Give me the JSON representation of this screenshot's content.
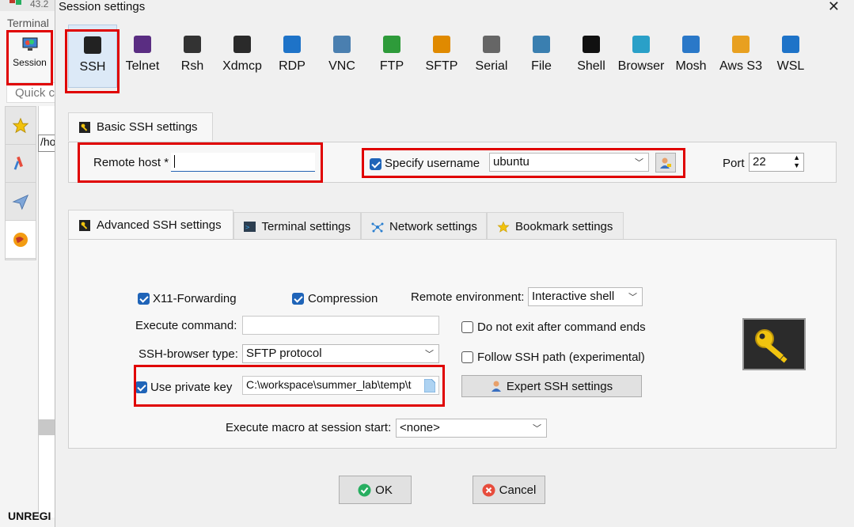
{
  "background_app": {
    "title_fragment": "43.2",
    "terminal_label": "Terminal",
    "session_button": "Session",
    "quick_connect": "Quick c",
    "path_fragment": "/ho",
    "unregistered": "UNREGI"
  },
  "dialog": {
    "title": "Session settings",
    "close": "✕"
  },
  "protocols": [
    {
      "label": "SSH",
      "icon": "ssh-key-icon",
      "color": "#222222",
      "selected": true
    },
    {
      "label": "Telnet",
      "icon": "telnet-icon",
      "color": "#5a2d82"
    },
    {
      "label": "Rsh",
      "icon": "rsh-icon",
      "color": "#333333"
    },
    {
      "label": "Xdmcp",
      "icon": "xdmcp-icon",
      "color": "#2a2a2a"
    },
    {
      "label": "RDP",
      "icon": "rdp-windows-icon",
      "color": "#1e73c8"
    },
    {
      "label": "VNC",
      "icon": "vnc-icon",
      "color": "#4a7fb0"
    },
    {
      "label": "FTP",
      "icon": "ftp-globe-icon",
      "color": "#2e9b3a"
    },
    {
      "label": "SFTP",
      "icon": "sftp-icon",
      "color": "#e08a00"
    },
    {
      "label": "Serial",
      "icon": "serial-plug-icon",
      "color": "#666666"
    },
    {
      "label": "File",
      "icon": "file-monitor-icon",
      "color": "#3a7fb0"
    },
    {
      "label": "Shell",
      "icon": "shell-terminal-icon",
      "color": "#111111"
    },
    {
      "label": "Browser",
      "icon": "browser-globe-icon",
      "color": "#2aa0c8"
    },
    {
      "label": "Mosh",
      "icon": "mosh-satellite-icon",
      "color": "#2a78c8"
    },
    {
      "label": "Aws S3",
      "icon": "aws-s3-cubes-icon",
      "color": "#e8a020"
    },
    {
      "label": "WSL",
      "icon": "wsl-windows-icon",
      "color": "#1e73c8"
    }
  ],
  "basic": {
    "tab_label": "Basic SSH settings",
    "remote_host_label": "Remote host *",
    "remote_host_value": "",
    "specify_username_label": "Specify username",
    "username_value": "ubuntu",
    "port_label": "Port",
    "port_value": "22"
  },
  "advanced_tabs": [
    {
      "label": "Advanced SSH settings",
      "icon": "key-icon",
      "active": true
    },
    {
      "label": "Terminal settings",
      "icon": "terminal-icon"
    },
    {
      "label": "Network settings",
      "icon": "network-icon"
    },
    {
      "label": "Bookmark settings",
      "icon": "star-icon"
    }
  ],
  "advanced": {
    "x11_label": "X11-Forwarding",
    "compression_label": "Compression",
    "remote_env_label": "Remote environment:",
    "remote_env_value": "Interactive shell",
    "exec_cmd_label": "Execute command:",
    "exec_cmd_value": "",
    "no_exit_label": "Do not exit after command ends",
    "browser_type_label": "SSH-browser type:",
    "browser_type_value": "SFTP protocol",
    "follow_path_label": "Follow SSH path (experimental)",
    "private_key_label": "Use private key",
    "private_key_value": "C:\\workspace\\summer_lab\\temp\\t",
    "expert_button": "Expert SSH settings",
    "macro_label": "Execute macro at session start:",
    "macro_value": "<none>"
  },
  "buttons": {
    "ok": "OK",
    "cancel": "Cancel"
  },
  "colors": {
    "highlight_red": "#e00000",
    "check_blue": "#1f64b8",
    "selected_tab": "#dce9f7"
  }
}
